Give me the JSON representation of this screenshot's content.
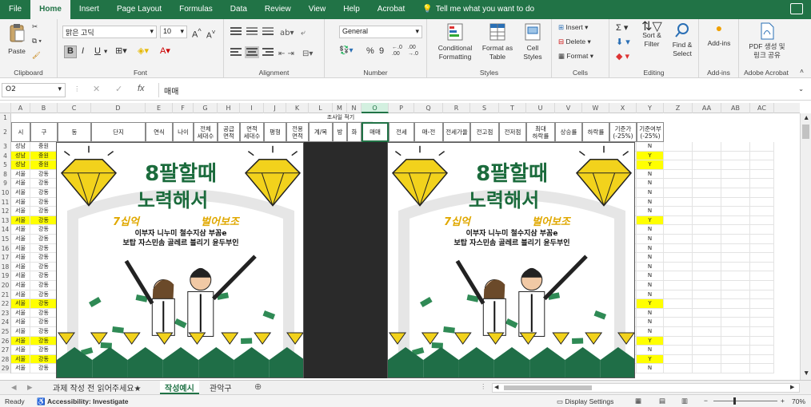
{
  "ribbon_tabs": [
    "File",
    "Home",
    "Insert",
    "Page Layout",
    "Formulas",
    "Data",
    "Review",
    "View",
    "Help",
    "Acrobat"
  ],
  "active_tab": "Home",
  "tell_me": "Tell me what you want to do",
  "clipboard": {
    "paste": "Paste",
    "label": "Clipboard"
  },
  "font": {
    "name": "맑은 고딕",
    "size": "10",
    "bold": "B",
    "italic": "I",
    "underline": "U",
    "label": "Font"
  },
  "alignment": {
    "label": "Alignment"
  },
  "number": {
    "format": "General",
    "label": "Number"
  },
  "styles": {
    "conditional": "Conditional Formatting",
    "format_table": "Format as Table",
    "cell_styles": "Cell Styles",
    "label": "Styles"
  },
  "cells": {
    "insert": "Insert",
    "delete": "Delete",
    "format": "Format",
    "label": "Cells"
  },
  "editing": {
    "sort": "Sort & Filter",
    "find": "Find & Select",
    "label": "Editing"
  },
  "addins": {
    "btn": "Add-ins",
    "label": "Add-ins"
  },
  "acrobat": {
    "btn1": "PDF 생성 및",
    "btn2": "링크 공유",
    "label": "Adobe Acrobat"
  },
  "formula_bar": {
    "cell_ref": "O2",
    "fx": "fx",
    "value": "매매"
  },
  "columns": [
    "A",
    "B",
    "C",
    "D",
    "E",
    "F",
    "G",
    "H",
    "I",
    "J",
    "K",
    "L",
    "M",
    "N",
    "O",
    "P",
    "Q",
    "R",
    "S",
    "T",
    "U",
    "V",
    "W",
    "X",
    "Y",
    "Z",
    "AA",
    "AB",
    "AC"
  ],
  "row1_title": "조사일 적기",
  "headers": [
    "시",
    "구",
    "동",
    "단지",
    "연식",
    "나이",
    "전체 세대수",
    "공급 면적",
    "면적 세대수",
    "평형",
    "전용 면적",
    "계/복",
    "방",
    "화",
    "매매",
    "전세",
    "매-전",
    "전세가율",
    "전고점",
    "전저점",
    "최대 하락률",
    "상승률",
    "하락률",
    "기준가 (-25%)",
    "기준여부 (-25%)"
  ],
  "rows": [
    {
      "n": "3",
      "a": "성남",
      "b": "중원",
      "y": "N",
      "hl": false
    },
    {
      "n": "4",
      "a": "성남",
      "b": "중원",
      "y": "Y",
      "hl": true
    },
    {
      "n": "5",
      "a": "성남",
      "b": "중원",
      "y": "Y",
      "hl": true
    },
    {
      "n": "8",
      "a": "서울",
      "b": "강동",
      "y": "N",
      "hl": false
    },
    {
      "n": "9",
      "a": "서울",
      "b": "강동",
      "y": "N",
      "hl": false
    },
    {
      "n": "10",
      "a": "서울",
      "b": "강동",
      "y": "N",
      "hl": false
    },
    {
      "n": "11",
      "a": "서울",
      "b": "강동",
      "y": "N",
      "hl": false
    },
    {
      "n": "12",
      "a": "서울",
      "b": "강동",
      "y": "N",
      "hl": false
    },
    {
      "n": "13",
      "a": "서울",
      "b": "강동",
      "y": "Y",
      "hl": true
    },
    {
      "n": "14",
      "a": "서울",
      "b": "강동",
      "y": "N",
      "hl": false
    },
    {
      "n": "15",
      "a": "서울",
      "b": "강동",
      "y": "N",
      "hl": false
    },
    {
      "n": "16",
      "a": "서울",
      "b": "강동",
      "y": "N",
      "hl": false
    },
    {
      "n": "17",
      "a": "서울",
      "b": "강동",
      "y": "N",
      "hl": false
    },
    {
      "n": "18",
      "a": "서울",
      "b": "강동",
      "y": "N",
      "hl": false
    },
    {
      "n": "19",
      "a": "서울",
      "b": "강동",
      "y": "N",
      "hl": false
    },
    {
      "n": "20",
      "a": "서울",
      "b": "강동",
      "y": "N",
      "hl": false
    },
    {
      "n": "21",
      "a": "서울",
      "b": "강동",
      "y": "N",
      "hl": false
    },
    {
      "n": "22",
      "a": "서울",
      "b": "강동",
      "y": "Y",
      "hl": true
    },
    {
      "n": "23",
      "a": "서울",
      "b": "강동",
      "y": "N",
      "hl": false
    },
    {
      "n": "24",
      "a": "서울",
      "b": "강동",
      "y": "N",
      "hl": false
    },
    {
      "n": "25",
      "a": "서울",
      "b": "강동",
      "y": "N",
      "hl": false
    },
    {
      "n": "26",
      "a": "서울",
      "b": "강동",
      "y": "Y",
      "hl": true
    },
    {
      "n": "27",
      "a": "서울",
      "b": "강동",
      "y": "N",
      "hl": false
    },
    {
      "n": "28",
      "a": "서울",
      "b": "강동",
      "y": "Y",
      "hl": true
    },
    {
      "n": "29",
      "a": "서울",
      "b": "강동",
      "y": "N",
      "hl": false
    }
  ],
  "poster": {
    "title1": "8팔할때",
    "title2": "노력해서",
    "num1": "7십억",
    "num2": "벌어보조",
    "line1": "이부자 니누미 철수지삼 부꼼e",
    "line2": "보탑 자스민솜 골레르 블리기  윤두부인"
  },
  "sheet_tabs": [
    "과제 작성 전 읽어주세요★",
    "작성예시",
    "관악구"
  ],
  "active_sheet": "작성예시",
  "status": {
    "ready": "Ready",
    "accessibility": "Accessibility: Investigate",
    "display": "Display Settings",
    "zoom": "70%"
  },
  "colors": {
    "excel_green": "#217346",
    "highlight": "#ffff00",
    "poster_green": "#1b6b3c",
    "diamond": "#f2d21c"
  }
}
